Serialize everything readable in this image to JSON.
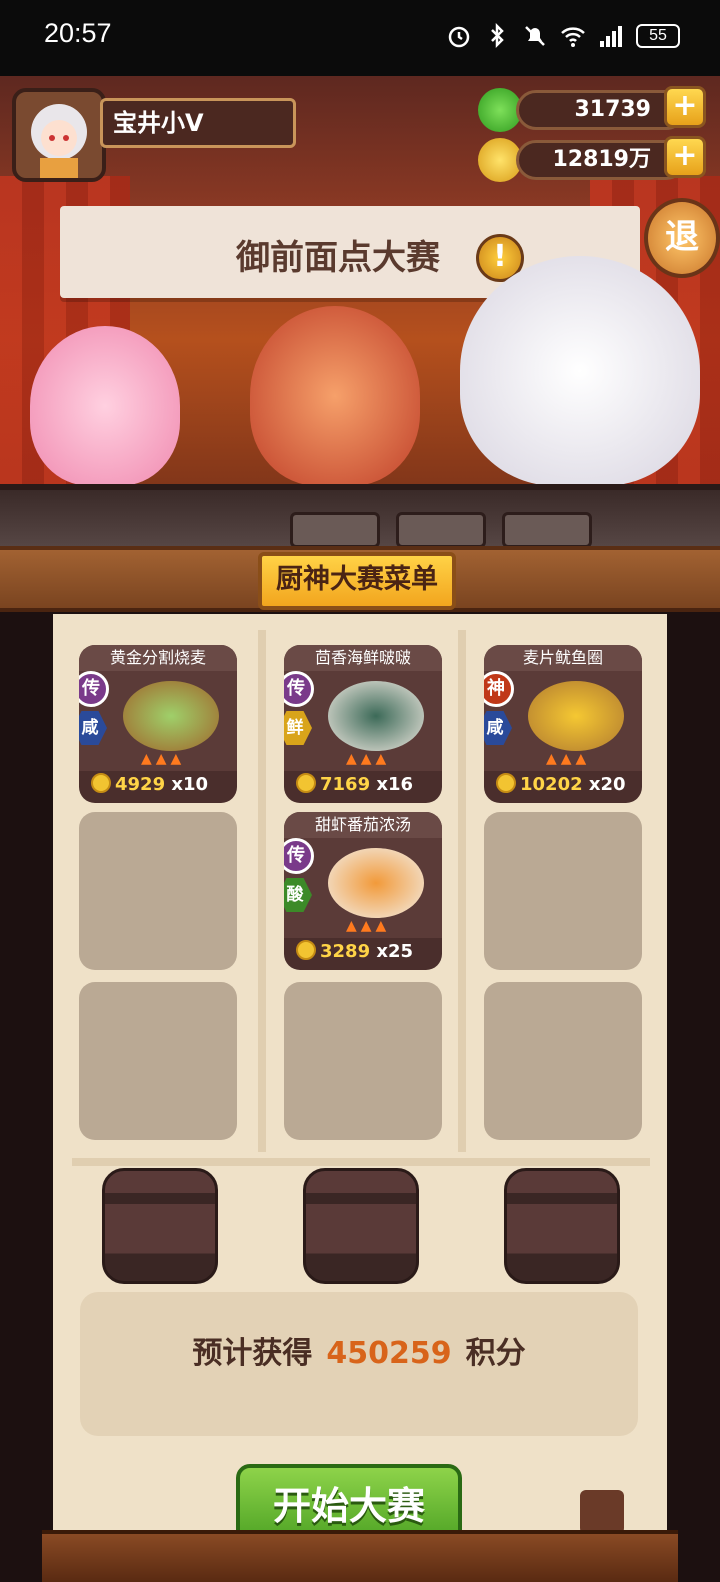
{
  "status_bar": {
    "time": "20:57",
    "battery": "55",
    "icons": [
      "alarm-icon",
      "bluetooth-icon",
      "mute-icon",
      "wifi-icon",
      "signal-icon"
    ]
  },
  "player": {
    "name": "宝井小V"
  },
  "resources": {
    "jade": "31739",
    "coins": "12819万"
  },
  "scene": {
    "event_title": "御前面点大赛",
    "exit_label": "退",
    "info_label": "!"
  },
  "menu": {
    "title": "厨神大赛菜单",
    "dishes": [
      {
        "name": "黄金分割烧麦",
        "rank": "传",
        "taste": "咸",
        "price": "4929",
        "qty": "x10"
      },
      {
        "name": "茴香海鲜啵啵",
        "rank": "传",
        "taste": "鲜",
        "price": "7169",
        "qty": "x16"
      },
      {
        "name": "麦片鱿鱼圈",
        "rank": "神",
        "taste": "咸",
        "price": "10202",
        "qty": "x20"
      },
      {
        "name": "甜虾番茄浓汤",
        "rank": "传",
        "taste": "酸",
        "price": "3289",
        "qty": "x25"
      }
    ]
  },
  "estimate": {
    "prefix": "预计获得",
    "value": "450259",
    "suffix": "积分"
  },
  "start_button": "开始大赛",
  "colors": {
    "accent_gold": "#f2a51e",
    "points_orange": "#d8641a",
    "start_green": "#4aa022"
  }
}
